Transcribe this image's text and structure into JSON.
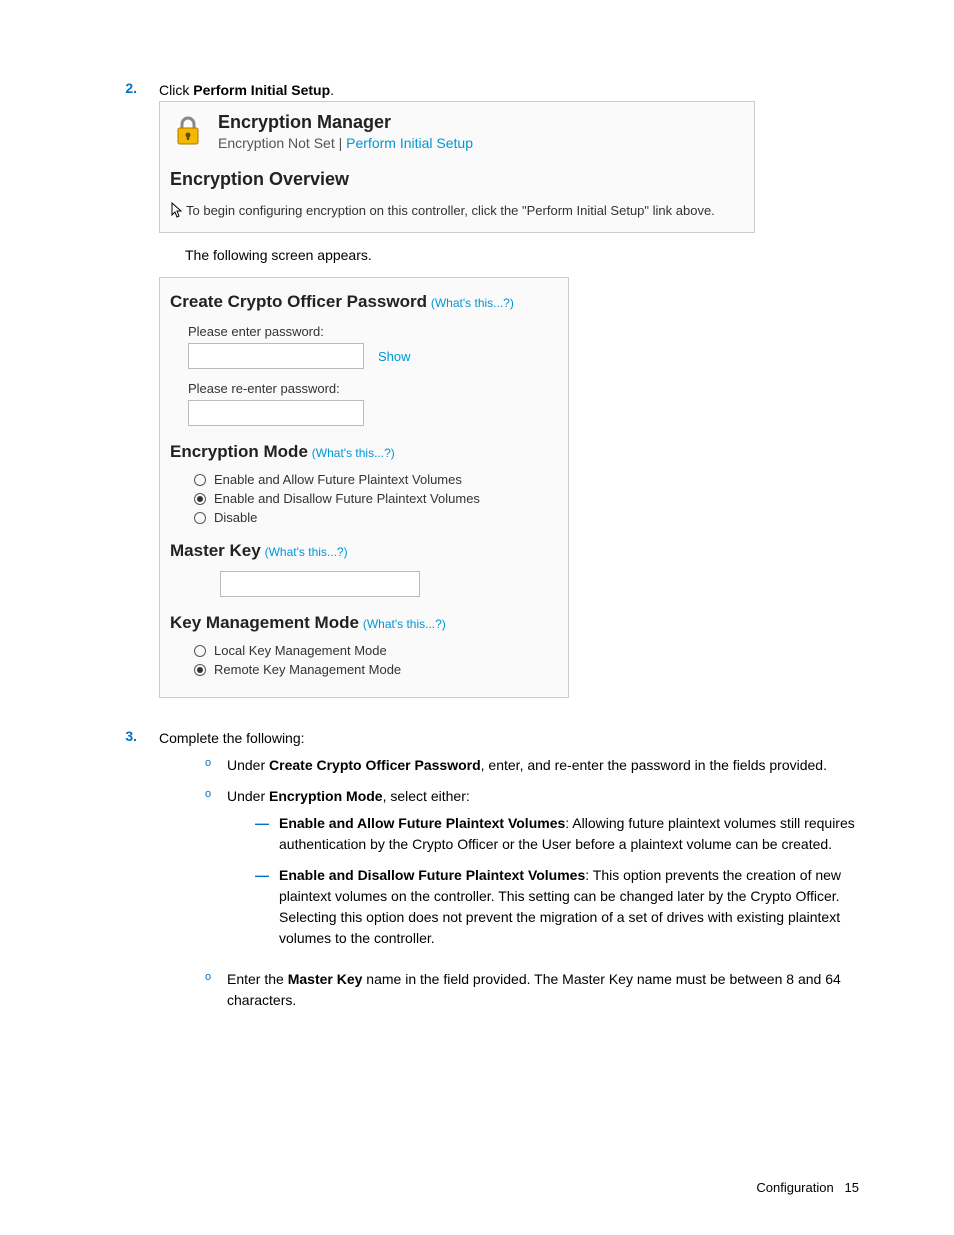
{
  "steps": {
    "s2": {
      "num": "2.",
      "prefix": "Click ",
      "bold": "Perform Initial Setup",
      "suffix": "."
    },
    "s3": {
      "num": "3.",
      "text": "Complete the following:"
    }
  },
  "shot1": {
    "title": "Encryption Manager",
    "status": "Encryption Not Set",
    "sep": " | ",
    "link": "Perform Initial Setup",
    "overview_title": "Encryption Overview",
    "overview_text": "To begin configuring encryption on this controller, click the \"Perform Initial Setup\" link above."
  },
  "narration1": "The following screen appears.",
  "shot2": {
    "h1": "Create Crypto Officer Password",
    "whats": "(What's this...?)",
    "label_enter": "Please enter password:",
    "show": "Show",
    "label_reenter": "Please re-enter password:",
    "h2": "Encryption Mode",
    "mode_opts": [
      "Enable and Allow Future Plaintext Volumes",
      "Enable and Disallow Future Plaintext Volumes",
      "Disable"
    ],
    "mode_selected": 1,
    "h3": "Master Key",
    "h4": "Key Management Mode",
    "km_opts": [
      "Local Key Management Mode",
      "Remote Key Management Mode"
    ],
    "km_selected": 1
  },
  "sub": {
    "a": {
      "pre": "Under ",
      "b": "Create Crypto Officer Password",
      "post": ", enter, and re-enter the password in the fields provided."
    },
    "b": {
      "pre": "Under ",
      "b": "Encryption Mode",
      "post": ", select either:"
    },
    "c": {
      "pre": "Enter the ",
      "b": "Master Key",
      "post": " name in the field provided. The Master Key name must be between 8 and 64 characters."
    }
  },
  "dash": {
    "a": {
      "b": "Enable and Allow Future Plaintext Volumes",
      "post": ": Allowing future plaintext volumes still requires authentication by the Crypto Officer or the User before a plaintext volume can be created."
    },
    "b": {
      "b": "Enable and Disallow Future Plaintext Volumes",
      "post": ": This option prevents the creation of new plaintext volumes on the controller. This setting can be changed later by the Crypto Officer. Selecting this option does not prevent the migration of a set of drives with existing plaintext volumes to the controller."
    }
  },
  "footer": {
    "label": "Configuration",
    "page": "15"
  }
}
